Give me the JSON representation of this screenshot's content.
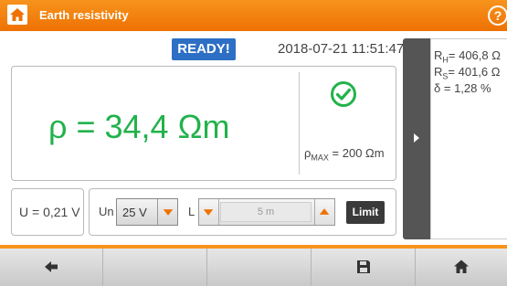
{
  "header": {
    "title": "Earth resistivity",
    "help_label": "?"
  },
  "status": {
    "ready_label": "READY!",
    "datetime": "2018-07-21 11:51:47"
  },
  "result": {
    "value_text": "ρ = 34,4 Ωm",
    "rho_max_prefix": "ρ",
    "rho_max_sub": "MAX",
    "rho_max_value": " = 200 Ωm"
  },
  "settings": {
    "u_value": "U = 0,21 V",
    "un_label": "Un",
    "un_value": "25 V",
    "l_label": "L",
    "l_value": "5 m",
    "limit_label": "Limit"
  },
  "side_panel": {
    "rh_label": "R",
    "rh_sub": "H",
    "rh_value": "= 406,8 Ω",
    "rs_label": "R",
    "rs_sub": "S",
    "rs_value": "= 401,6 Ω",
    "delta_label": "δ",
    "delta_value": " = 1,28 %"
  },
  "footer": {
    "buttons": [
      "back-icon",
      "",
      "",
      "save-icon",
      "home-icon"
    ]
  },
  "colors": {
    "accent": "#f7941d",
    "result_green": "#22b24c",
    "ready_blue": "#2d6fc4"
  }
}
